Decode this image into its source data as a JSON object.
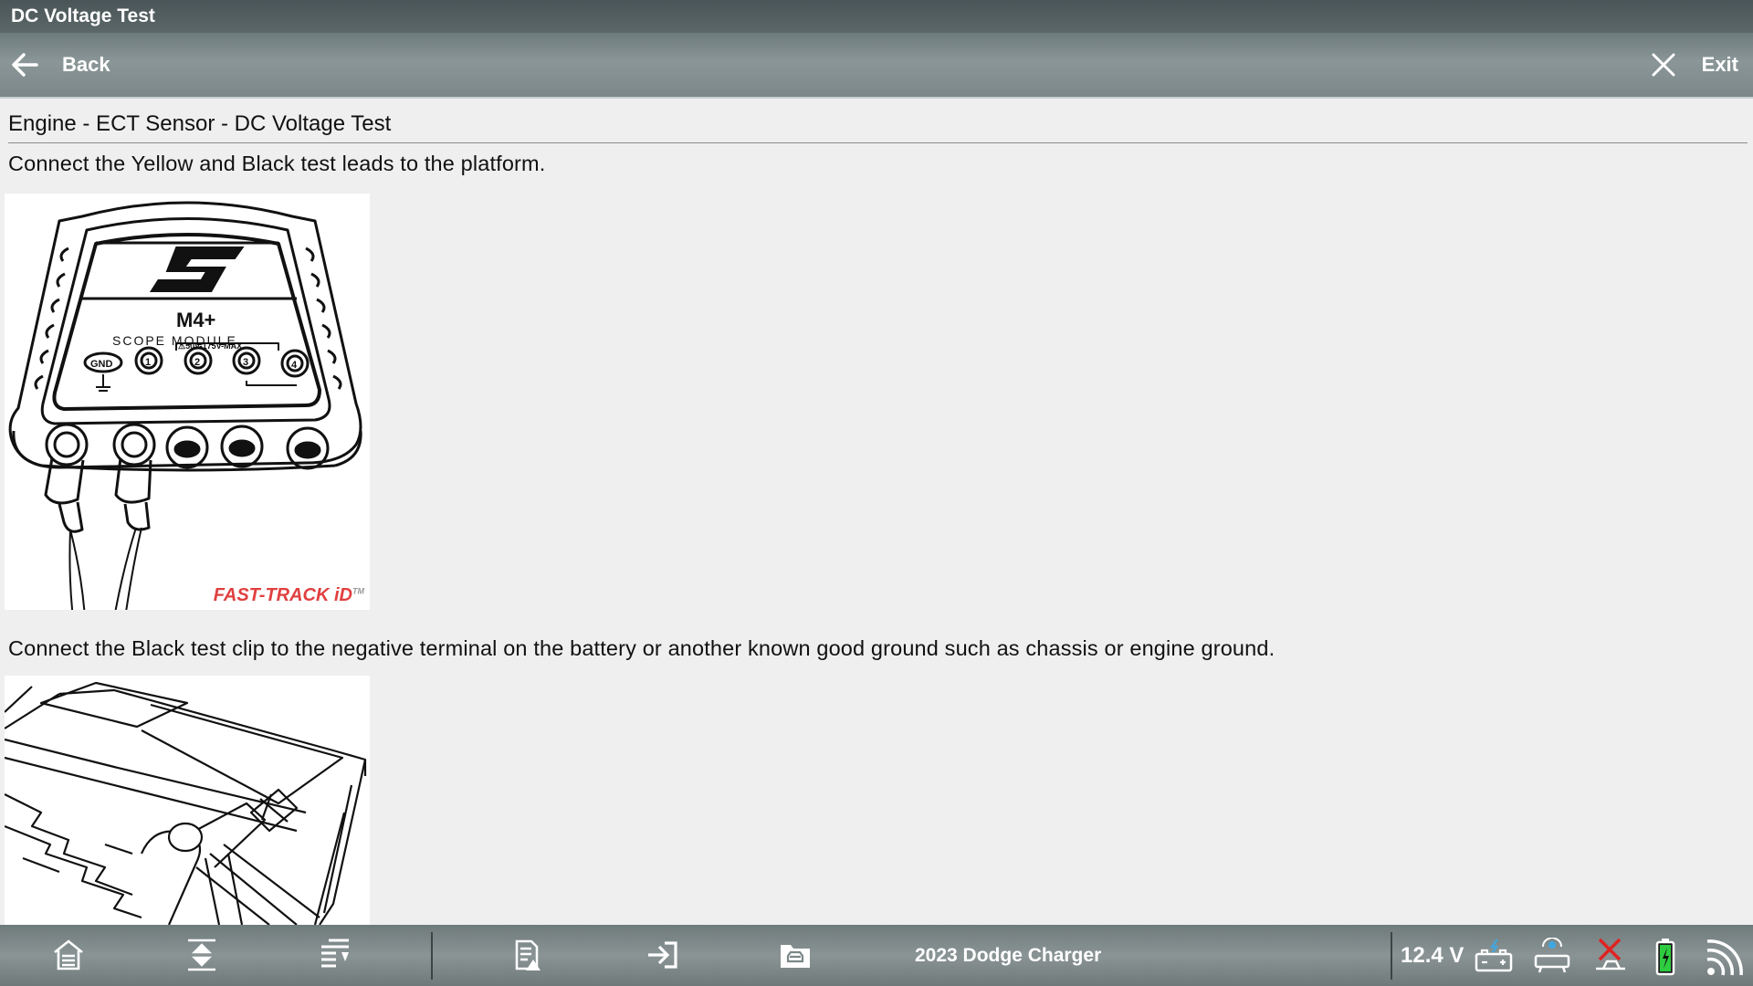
{
  "window": {
    "title": "DC Voltage Test"
  },
  "nav": {
    "back_label": "Back",
    "exit_label": "Exit"
  },
  "content": {
    "section_title": "Engine - ECT Sensor - DC Voltage Test",
    "step1": "Connect the Yellow and Black test leads to the platform.",
    "step1_image": {
      "logo_text": "S",
      "module_name": "M4+",
      "module_label": "SCOPE MODULE",
      "warning": "⚠50V-175V-MAX",
      "ports": [
        "GND",
        "1",
        "2",
        "3",
        "4"
      ],
      "brand": "FAST-TRACK iD",
      "brand_mark": "TM"
    },
    "step2": "Connect the Black test clip to the negative terminal on the battery or another known good ground such as chassis or engine ground."
  },
  "bottom": {
    "vehicle": "2023 Dodge Charger",
    "voltage": "12.4 V",
    "icons": [
      "home-icon",
      "scroll-top-icon",
      "scroll-bottom-icon",
      "report-icon",
      "import-icon",
      "vehicle-folder-icon",
      "battery-connection-icon",
      "vci-icon",
      "disconnect-icon",
      "battery-icon",
      "wifi-icon"
    ]
  }
}
